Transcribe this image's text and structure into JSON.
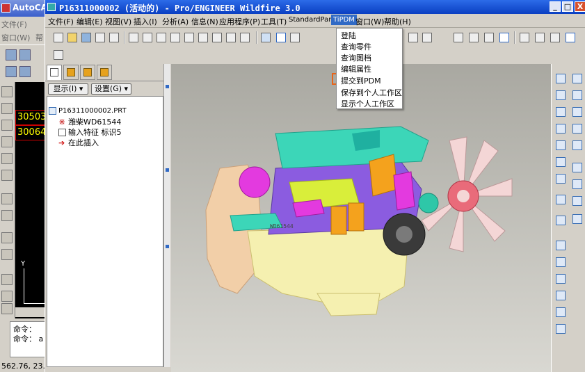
{
  "background_app": {
    "title": "AutoCAD",
    "menu_file": "文件(F)",
    "menu_window": "窗口(W)",
    "menu_help": "帮",
    "coord_1": "30503",
    "coord_2": "30064",
    "axis_label": "Y",
    "command_line_1": "命令：",
    "command_line_2": "命令：",
    "command_line_2_tail": "a",
    "status_coords": "562.76, 23."
  },
  "window": {
    "title": "P16311000002 (活动的) - Pro/ENGINEER Wildfire 3.0",
    "min_label": "_",
    "max_label": "□",
    "close_label": "X"
  },
  "menubar": {
    "items": [
      {
        "label": "文件(F)"
      },
      {
        "label": "编辑(E)"
      },
      {
        "label": "视图(V)"
      },
      {
        "label": "插入(I)"
      },
      {
        "label": "分析(A)"
      },
      {
        "label": "信息(N)"
      },
      {
        "label": "应用程序(P)"
      },
      {
        "label": "工具(T)"
      },
      {
        "label": "StandardPart"
      },
      {
        "label": "TiPDM"
      },
      {
        "label": "窗口(W)"
      },
      {
        "label": "帮助(H)"
      }
    ],
    "active_index": 9
  },
  "tipdm_menu": {
    "items": [
      {
        "label": "登陆"
      },
      {
        "label": "查询零件"
      },
      {
        "label": "查询图档"
      },
      {
        "label": "编辑属性"
      },
      {
        "label": "提交到PDM"
      },
      {
        "label": "保存到个人工作区"
      },
      {
        "label": "显示个人工作区"
      }
    ],
    "highlighted_index": 4,
    "highlight_color": "#e8641a"
  },
  "model_tree": {
    "show_button": "显示(I)",
    "settings_button": "设置(G)",
    "rows": [
      {
        "label": "P16311000002.PRT",
        "icon": "part-icon"
      },
      {
        "label": "潍柴WD61544",
        "icon": "feature-icon"
      },
      {
        "label": "输入特征 标识5",
        "icon": "import-feature-icon"
      },
      {
        "label": "在此插入",
        "icon": "insert-here-arrow-icon"
      }
    ]
  },
  "model": {
    "label": "WD61544",
    "colors": {
      "block": "#3cd6b8",
      "oil_pan": "#f5f0b0",
      "flywheel_housing": "#f2cfa8",
      "magenta": "#e33adf",
      "orange": "#f4a21d",
      "fan": "#f4d6d6",
      "yellow_green": "#d9ee3a"
    }
  },
  "colors": {
    "title_bar": "#0a3fc2",
    "menu_highlight": "#316ac5",
    "viewport_top": "#a9a8a1",
    "viewport_bottom": "#d9d8d2"
  }
}
